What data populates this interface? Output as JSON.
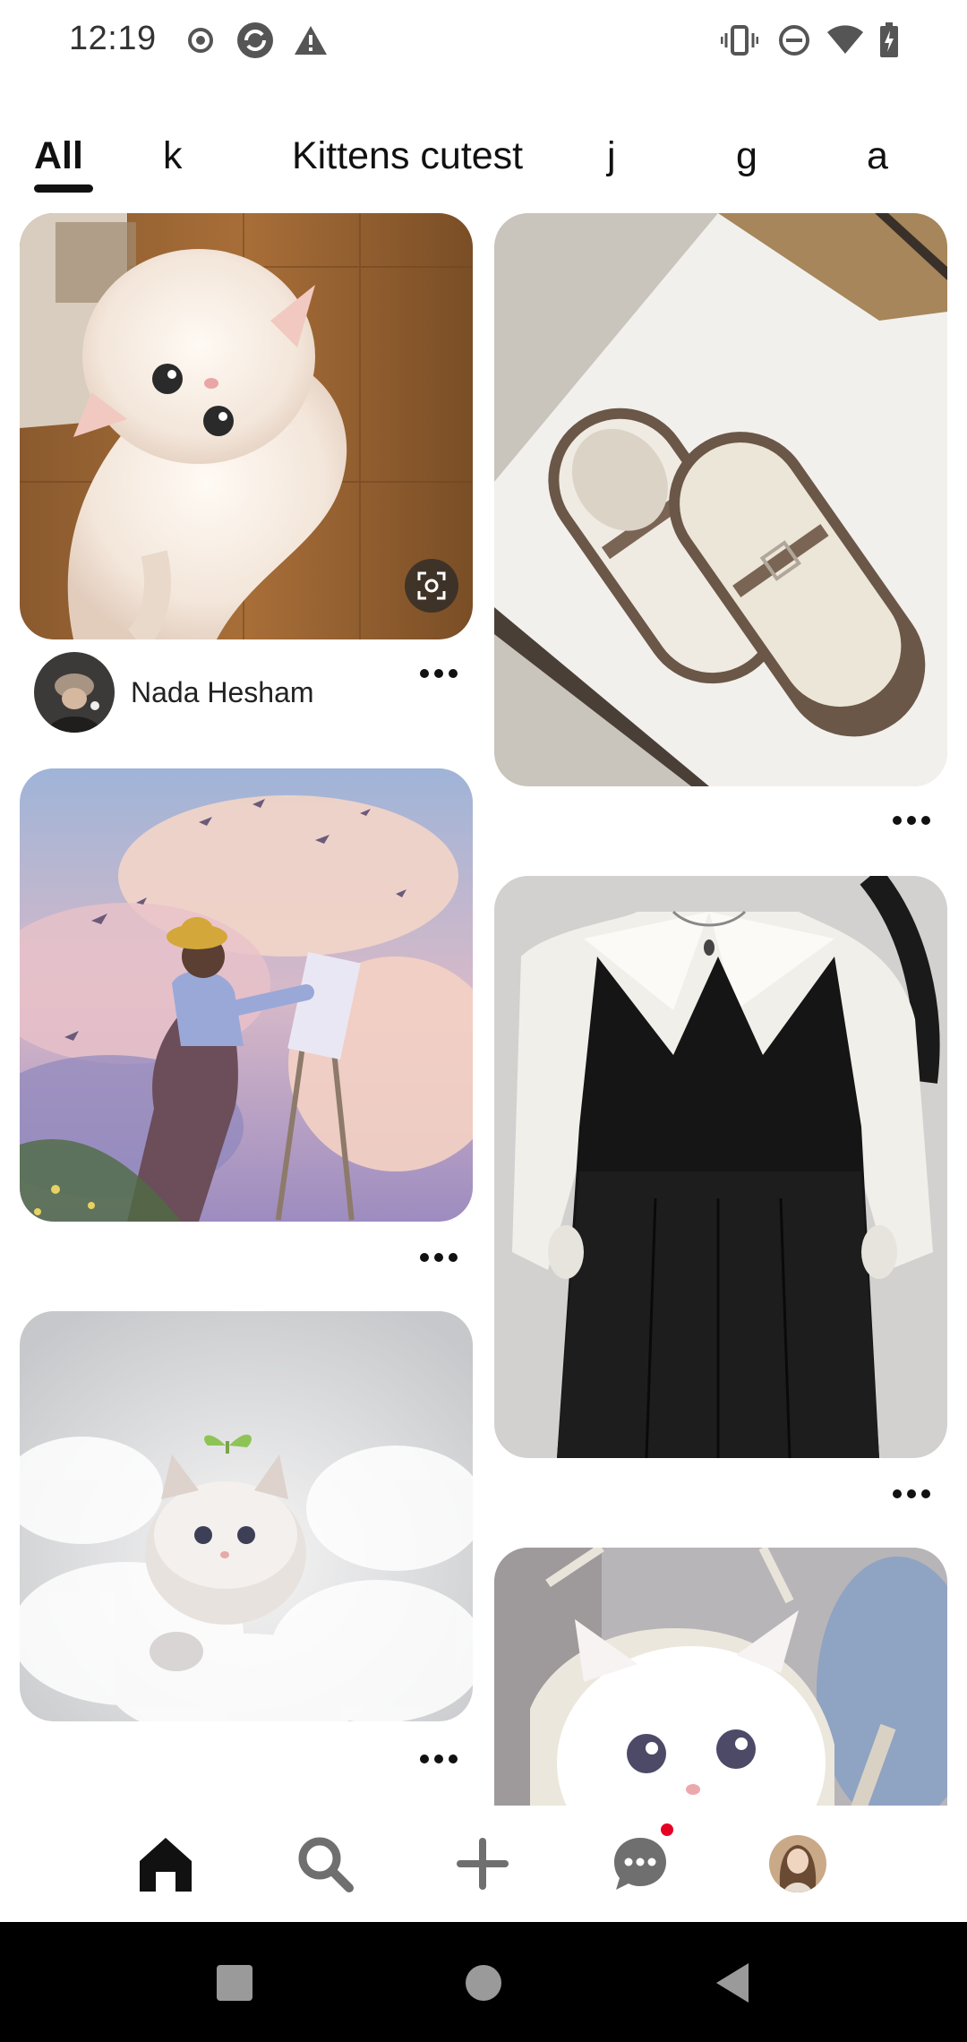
{
  "status_bar": {
    "time": "12:19",
    "left_icons": [
      "record-icon",
      "sync-app-icon",
      "warning-icon"
    ],
    "right_icons": [
      "vibrate-icon",
      "do-not-disturb-icon",
      "wifi-icon",
      "battery-charging-icon"
    ]
  },
  "tabs": [
    {
      "label": "All",
      "active": true
    },
    {
      "label": "k",
      "active": false
    },
    {
      "label": "Kittens cutest",
      "active": false
    },
    {
      "label": "j",
      "active": false
    },
    {
      "label": "g",
      "active": false
    },
    {
      "label": "a",
      "active": false
    }
  ],
  "feed": {
    "pins": [
      {
        "subject": "fluffy white kitten on wooden floor",
        "column": "left",
        "has_attribution": true,
        "has_visual_search": true
      },
      {
        "subject": "beige mary jane shoes in box",
        "column": "right"
      },
      {
        "subject": "illustrated girl painting in clouds",
        "column": "left"
      },
      {
        "subject": "black pinafore dress with white collar blouse",
        "column": "right"
      },
      {
        "subject": "white kitten in bubble bath with sprout",
        "column": "left"
      },
      {
        "subject": "white kitten in a bag",
        "column": "right"
      }
    ],
    "attribution": {
      "name": "Nada Hesham",
      "avatar_icon": "user-avatar"
    }
  },
  "bottom_nav": {
    "items": [
      {
        "name": "home-icon",
        "active": true
      },
      {
        "name": "search-icon",
        "active": false
      },
      {
        "name": "create-plus-icon",
        "active": false
      },
      {
        "name": "messages-icon",
        "active": false,
        "badge": true
      },
      {
        "name": "profile-avatar",
        "active": false
      }
    ],
    "accent_color": "#e60023"
  },
  "system_nav": [
    "recents-icon",
    "home-circle-icon",
    "back-triangle-icon"
  ]
}
